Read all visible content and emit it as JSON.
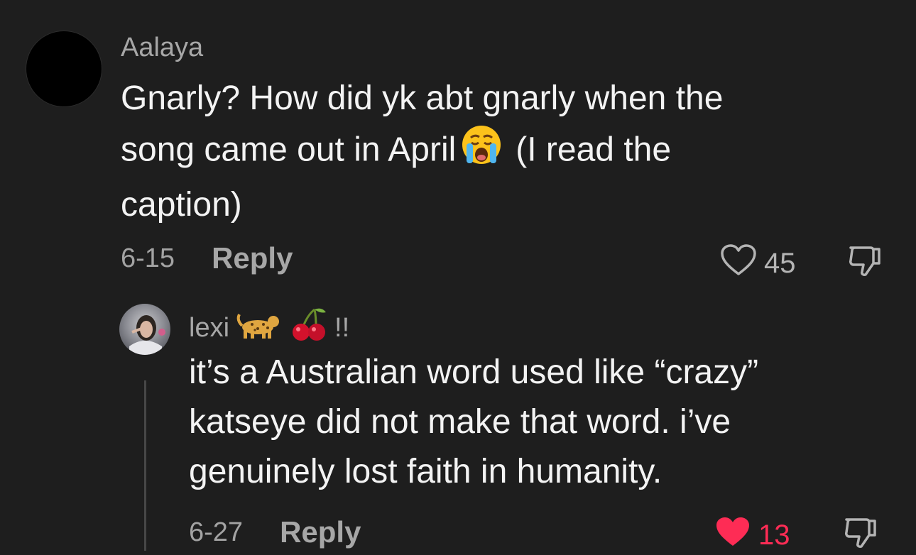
{
  "comment": {
    "username": "Aalaya",
    "lines": [
      "Gnarly? How did yk abt gnarly when the",
      "song came out in April",
      "(I read the",
      "caption)"
    ],
    "emoji_icon": "crying-face-icon",
    "date": "6-15",
    "reply_label": "Reply",
    "like_count": "45",
    "liked": false
  },
  "reply": {
    "username": "lexi",
    "username_suffix": "!!",
    "username_emojis": [
      "leopard-icon",
      "cherries-icon"
    ],
    "lines": [
      "it’s a Australian word used like “crazy”",
      "katseye did not make that word. i’ve",
      "genuinely lost faith in humanity."
    ],
    "date": "6-27",
    "reply_label": "Reply",
    "like_count": "13",
    "liked": true
  },
  "colors": {
    "background": "#1e1e1e",
    "liked_heart": "#fe2c55",
    "meta_text": "#a3a3a3"
  }
}
